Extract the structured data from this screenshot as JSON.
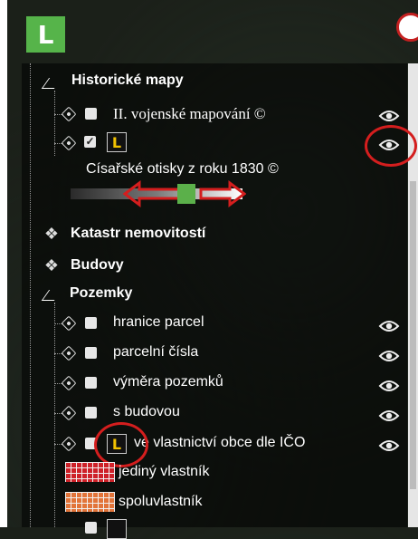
{
  "app": {
    "logo_letter": "L"
  },
  "tree": {
    "historic": {
      "label": "Historické mapy",
      "items": [
        {
          "label": "II. vojenské mapování ©",
          "checked": false
        },
        {
          "label": "",
          "checked": true,
          "layer_icon": "L"
        }
      ],
      "layer_title": "Císařské otisky z roku 1830 ©",
      "opacity": 0.75
    },
    "cadastre": {
      "label": "Katastr nemovitostí"
    },
    "buildings": {
      "label": "Budovy"
    },
    "parcels": {
      "label": "Pozemky",
      "items": [
        {
          "label": "hranice parcel"
        },
        {
          "label": "parcelní čísla"
        },
        {
          "label": "výměra pozemků"
        },
        {
          "label": "s budovou"
        },
        {
          "label": "ve vlastnictví obce dle IČO",
          "layer_icon": "L"
        }
      ],
      "legend": [
        {
          "label": "jediný vlastník",
          "color": "#d9222a"
        },
        {
          "label": "spoluvlastník",
          "color": "#ee7a3c"
        }
      ]
    }
  },
  "icons": {
    "collapse": "chevron-collapse-icon",
    "expand": "gear-expand-icon",
    "visibility": "eye-icon",
    "layer": "layer-l-icon"
  },
  "colors": {
    "accent_green": "#56b44a",
    "annotation_red": "#d41e1e",
    "layer_icon_yellow": "#f2c200"
  }
}
